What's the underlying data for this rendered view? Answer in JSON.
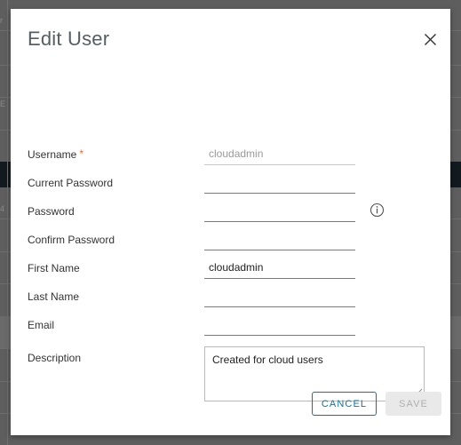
{
  "dialog": {
    "title": "Edit User",
    "close_icon": "close-icon"
  },
  "form": {
    "fields": [
      {
        "key": "username",
        "label": "Username",
        "required": true,
        "value": "cloudadmin",
        "placeholder": "",
        "readonly": true,
        "type": "text"
      },
      {
        "key": "current_password",
        "label": "Current Password",
        "required": false,
        "value": "",
        "placeholder": "",
        "readonly": false,
        "type": "password"
      },
      {
        "key": "password",
        "label": "Password",
        "required": false,
        "value": "",
        "placeholder": "",
        "readonly": false,
        "type": "password",
        "info_icon": "info-icon"
      },
      {
        "key": "confirm_password",
        "label": "Confirm Password",
        "required": false,
        "value": "",
        "placeholder": "",
        "readonly": false,
        "type": "password"
      },
      {
        "key": "first_name",
        "label": "First Name",
        "required": false,
        "value": "cloudadmin",
        "placeholder": "",
        "readonly": false,
        "type": "text"
      },
      {
        "key": "last_name",
        "label": "Last Name",
        "required": false,
        "value": "",
        "placeholder": "",
        "readonly": false,
        "type": "text"
      },
      {
        "key": "email",
        "label": "Email",
        "required": false,
        "value": "",
        "placeholder": "",
        "readonly": false,
        "type": "text"
      }
    ],
    "description": {
      "label": "Description",
      "value": "Created for cloud users",
      "placeholder": ""
    },
    "required_marker": "*"
  },
  "footer": {
    "cancel_label": "CANCEL",
    "save_label": "SAVE",
    "save_disabled": true
  },
  "colors": {
    "accent": "#0a76a8",
    "required": "#e36c3a",
    "title": "#565e63",
    "disabled_button_bg": "#e9e9e9",
    "disabled_button_text": "#b0b0b0",
    "scrim": "#5e5e5e"
  },
  "background": {
    "visible_text": [
      "r",
      "E",
      "4"
    ]
  }
}
